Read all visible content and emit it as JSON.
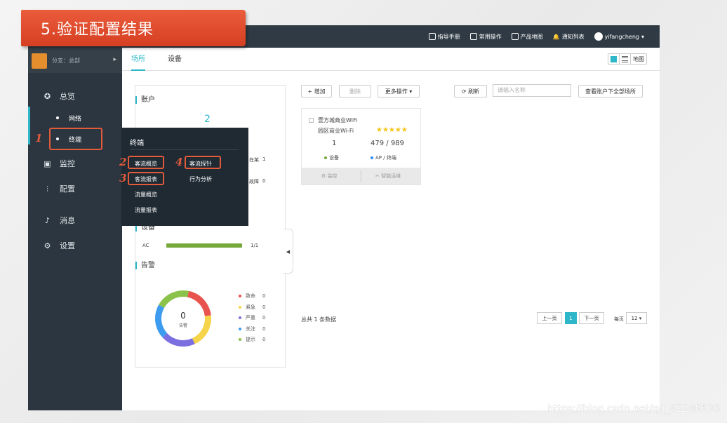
{
  "slide": {
    "banner_title": "5.验证配置结果",
    "watermark": "https://blog.csdn.net/qq_42248536"
  },
  "topnav": {
    "items": [
      "指导手册",
      "常用操作",
      "产品地图",
      "通知列表"
    ],
    "user": "yifangcheng"
  },
  "sidebar": {
    "branch": "分支：总部",
    "items": {
      "overview": "总览",
      "network": "网络",
      "terminal": "终端",
      "monitor": "监控",
      "config": "配置",
      "message": "消息",
      "settings": "设置"
    }
  },
  "flyout": {
    "title": "终端",
    "links": [
      "客流概览",
      "客流探针",
      "客流报表",
      "行为分析",
      "流量概览",
      "流量报表"
    ]
  },
  "steps": [
    "1",
    "2",
    "3",
    "4"
  ],
  "tabs": [
    "场所",
    "设备"
  ],
  "view_toggle": {
    "map": "地图"
  },
  "left_panel": {
    "account_title": "账户",
    "account_count": "2",
    "partial_1_label": "在某",
    "partial_1_value": "1",
    "partial_2_label": "故障",
    "partial_2_value": "0",
    "device_title": "设备",
    "device_row": {
      "label": "AC",
      "value": "1/1",
      "ratio": 1.0
    },
    "alarm_title": "告警",
    "donut_value": "0",
    "donut_label": "告警",
    "legend": [
      {
        "label": "致命",
        "value": "0",
        "color": "#e8534e"
      },
      {
        "label": "紧急",
        "value": "0",
        "color": "#f5d44a"
      },
      {
        "label": "严重",
        "value": "0",
        "color": "#7b6fe0"
      },
      {
        "label": "关注",
        "value": "0",
        "color": "#3d9cf0"
      },
      {
        "label": "提示",
        "value": "0",
        "color": "#8bc24a"
      }
    ]
  },
  "toolbar": {
    "add": "+ 增加",
    "delete": "删除",
    "more": "更多操作 ▾",
    "refresh": "刷新",
    "search_placeholder": "请输入名称",
    "view_all": "查看账户下全部场所"
  },
  "card": {
    "name_line1": "壹方城商业WiFi",
    "name_line2": "园区商业Wi-Fi",
    "stars": "★★★★★",
    "rating": 5,
    "device_count": "1",
    "device_label": "设备",
    "ap_count": "479 / 989",
    "ap_label": "AP / 终端",
    "foot_monitor": "监控",
    "foot_ops": "智能运维"
  },
  "pagination": {
    "total": "总共 1 条数据",
    "prev": "上一页",
    "current": "1",
    "next": "下一页",
    "per_page_label": "每页",
    "per_page": "12 ▾"
  },
  "colors": {
    "accent": "#2db7c9",
    "sidebar": "#2b3640",
    "highlight": "#e25b3a"
  }
}
